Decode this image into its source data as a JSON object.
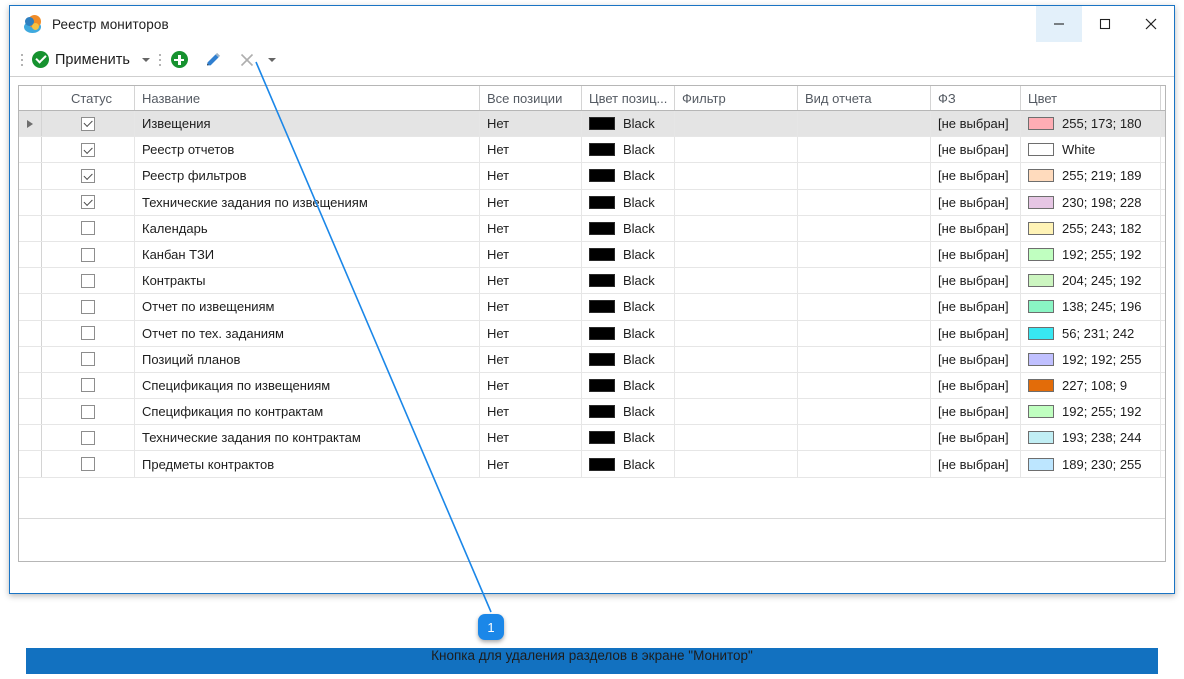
{
  "window": {
    "title": "Реестр мониторов",
    "app_icon": "app-logo-icon",
    "controls": {
      "minimize": "—",
      "maximize": "□",
      "close": "✕"
    }
  },
  "toolbar": {
    "apply_label": "Применить",
    "apply_icon": "check-circle-icon",
    "apply_caret": "▾",
    "add_icon": "plus-circle-icon",
    "edit_icon": "pencil-icon",
    "delete_icon": "cross-icon",
    "delete_caret": "▾"
  },
  "grid": {
    "columns": [
      {
        "key": "indicator",
        "label": ""
      },
      {
        "key": "status",
        "label": "Статус"
      },
      {
        "key": "name",
        "label": "Название"
      },
      {
        "key": "all_positions",
        "label": "Все позиции"
      },
      {
        "key": "position_color",
        "label": "Цвет позиц..."
      },
      {
        "key": "filter",
        "label": "Фильтр"
      },
      {
        "key": "report_view",
        "label": "Вид отчета"
      },
      {
        "key": "fz",
        "label": "ФЗ"
      },
      {
        "key": "color",
        "label": "Цвет"
      }
    ],
    "rows": [
      {
        "selected": true,
        "checked": true,
        "name": "Извещения",
        "all_positions": "Нет",
        "position_color": "Black",
        "position_color_hex": "#000000",
        "filter": "",
        "report_view": "",
        "fz": "[не выбран]",
        "color": "255; 173; 180",
        "color_hex": "#ffadb4"
      },
      {
        "selected": false,
        "checked": true,
        "name": "Реестр отчетов",
        "all_positions": "Нет",
        "position_color": "Black",
        "position_color_hex": "#000000",
        "filter": "",
        "report_view": "",
        "fz": "[не выбран]",
        "color": "White",
        "color_hex": "#ffffff"
      },
      {
        "selected": false,
        "checked": true,
        "name": "Реестр фильтров",
        "all_positions": "Нет",
        "position_color": "Black",
        "position_color_hex": "#000000",
        "filter": "",
        "report_view": "",
        "fz": "[не выбран]",
        "color": "255; 219; 189",
        "color_hex": "#ffdbbd"
      },
      {
        "selected": false,
        "checked": true,
        "name": "Технические задания по извещениям",
        "all_positions": "Нет",
        "position_color": "Black",
        "position_color_hex": "#000000",
        "filter": "",
        "report_view": "",
        "fz": "[не выбран]",
        "color": "230; 198; 228",
        "color_hex": "#e6c6e4"
      },
      {
        "selected": false,
        "checked": false,
        "name": "Календарь",
        "all_positions": "Нет",
        "position_color": "Black",
        "position_color_hex": "#000000",
        "filter": "",
        "report_view": "",
        "fz": "[не выбран]",
        "color": "255; 243; 182",
        "color_hex": "#fff3b6"
      },
      {
        "selected": false,
        "checked": false,
        "name": "Канбан ТЗИ",
        "all_positions": "Нет",
        "position_color": "Black",
        "position_color_hex": "#000000",
        "filter": "",
        "report_view": "",
        "fz": "[не выбран]",
        "color": "192; 255; 192",
        "color_hex": "#c0ffc0"
      },
      {
        "selected": false,
        "checked": false,
        "name": "Контракты",
        "all_positions": "Нет",
        "position_color": "Black",
        "position_color_hex": "#000000",
        "filter": "",
        "report_view": "",
        "fz": "[не выбран]",
        "color": "204; 245; 192",
        "color_hex": "#ccf5c0"
      },
      {
        "selected": false,
        "checked": false,
        "name": "Отчет по извещениям",
        "all_positions": "Нет",
        "position_color": "Black",
        "position_color_hex": "#000000",
        "filter": "",
        "report_view": "",
        "fz": "[не выбран]",
        "color": "138; 245; 196",
        "color_hex": "#8af5c4"
      },
      {
        "selected": false,
        "checked": false,
        "name": "Отчет по тех. заданиям",
        "all_positions": "Нет",
        "position_color": "Black",
        "position_color_hex": "#000000",
        "filter": "",
        "report_view": "",
        "fz": "[не выбран]",
        "color": "56; 231; 242",
        "color_hex": "#38e7f2"
      },
      {
        "selected": false,
        "checked": false,
        "name": "Позиций планов",
        "all_positions": "Нет",
        "position_color": "Black",
        "position_color_hex": "#000000",
        "filter": "",
        "report_view": "",
        "fz": "[не выбран]",
        "color": "192; 192; 255",
        "color_hex": "#c0c0ff"
      },
      {
        "selected": false,
        "checked": false,
        "name": "Спецификация по извещениям",
        "all_positions": "Нет",
        "position_color": "Black",
        "position_color_hex": "#000000",
        "filter": "",
        "report_view": "",
        "fz": "[не выбран]",
        "color": "227; 108; 9",
        "color_hex": "#e36c09"
      },
      {
        "selected": false,
        "checked": false,
        "name": "Спецификация по контрактам",
        "all_positions": "Нет",
        "position_color": "Black",
        "position_color_hex": "#000000",
        "filter": "",
        "report_view": "",
        "fz": "[не выбран]",
        "color": "192; 255; 192",
        "color_hex": "#c0ffc0"
      },
      {
        "selected": false,
        "checked": false,
        "name": "Технические задания по контрактам",
        "all_positions": "Нет",
        "position_color": "Black",
        "position_color_hex": "#000000",
        "filter": "",
        "report_view": "",
        "fz": "[не выбран]",
        "color": "193; 238; 244",
        "color_hex": "#c1eef4"
      },
      {
        "selected": false,
        "checked": false,
        "name": "Предметы контрактов",
        "all_positions": "Нет",
        "position_color": "Black",
        "position_color_hex": "#000000",
        "filter": "",
        "report_view": "",
        "fz": "[не выбран]",
        "color": "189; 230; 255",
        "color_hex": "#bde6ff"
      }
    ]
  },
  "annotation": {
    "number": "1",
    "caption": "Кнопка для удаления разделов в экране \"Монитор\"",
    "line_color": "#1b87e8"
  },
  "colors": {
    "accent": "#1271c0",
    "window_border": "#1a74c4",
    "badge": "#1b87e8",
    "green": "#16922f",
    "selection": "#e4e4e4"
  }
}
